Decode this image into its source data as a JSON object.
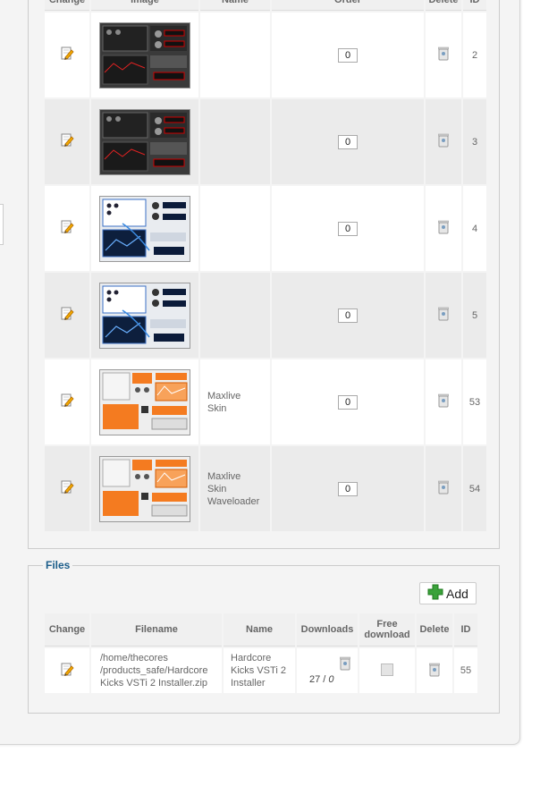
{
  "images_table": {
    "headers": [
      "Change",
      "Image",
      "Name",
      "Order",
      "Delete",
      "ID"
    ],
    "rows": [
      {
        "id": "2",
        "name": "",
        "order": "0",
        "theme": "dark"
      },
      {
        "id": "3",
        "name": "",
        "order": "0",
        "theme": "dark"
      },
      {
        "id": "4",
        "name": "",
        "order": "0",
        "theme": "white"
      },
      {
        "id": "5",
        "name": "",
        "order": "0",
        "theme": "white"
      },
      {
        "id": "53",
        "name": "Maxlive\nSkin",
        "order": "0",
        "theme": "orange"
      },
      {
        "id": "54",
        "name": "Maxlive\nSkin\nWaveloader",
        "order": "0",
        "theme": "orange"
      }
    ]
  },
  "files": {
    "legend": "Files",
    "add_label": "Add",
    "headers": [
      "Change",
      "Filename",
      "Name",
      "Downloads",
      "Free download",
      "Delete",
      "ID"
    ],
    "rows": [
      {
        "filename": "/home/thecores\n/products_safe/Hardcore\nKicks VSTi 2 Installer.zip",
        "name": "Hardcore\nKicks VSTi 2\nInstaller",
        "downloads": "27 /",
        "downloads_free": "0",
        "free": false,
        "id": "55"
      }
    ]
  },
  "colors": {
    "legend": "#1b5d8a",
    "panel_bg": "#f4f4f4",
    "row_alt": "#ebebeb",
    "add_icon": "#3aa23a"
  },
  "icons": {
    "change": "edit-pencil-icon",
    "delete": "trash-icon",
    "add": "plus-icon"
  }
}
